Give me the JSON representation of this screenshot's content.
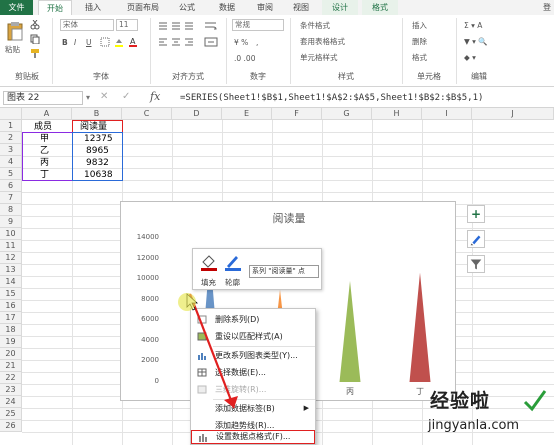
{
  "ribbon": {
    "tabs": [
      "文件",
      "开始",
      "插入",
      "页面布局",
      "公式",
      "数据",
      "审阅",
      "视图",
      "设计",
      "格式"
    ],
    "right_edge": "登",
    "paste_label": "粘贴",
    "font_name": "宋体",
    "font_size": "11",
    "number_format": "常规",
    "styles": [
      "条件格式",
      "套用表格格式",
      "单元格样式"
    ],
    "cells": [
      "插入",
      "删除",
      "格式"
    ],
    "groups": [
      "剪贴板",
      "字体",
      "对齐方式",
      "数字",
      "样式",
      "单元格",
      "编辑"
    ]
  },
  "formula_bar": {
    "name_box": "图表 22",
    "fx": "fx",
    "formula": "=SERIES(Sheet1!$B$1,Sheet1!$A$2:$A$5,Sheet1!$B$2:$B$5,1)"
  },
  "sheet": {
    "columns": [
      "A",
      "B",
      "C",
      "D",
      "E",
      "F",
      "G",
      "H",
      "I",
      "J"
    ],
    "rows": [
      "1",
      "2",
      "3",
      "4",
      "5",
      "6",
      "7",
      "8",
      "9",
      "10",
      "11",
      "12",
      "13",
      "14",
      "15",
      "16",
      "17",
      "18",
      "19",
      "20",
      "21",
      "22",
      "23",
      "24",
      "25",
      "26"
    ],
    "cells": {
      "A1": "成员",
      "B1": "阅读量",
      "A2": "甲",
      "B2": "12375",
      "A3": "乙",
      "B3": "8965",
      "A4": "丙",
      "B4": "9832",
      "A5": "丁",
      "B5": "10638"
    }
  },
  "chart_data": {
    "type": "bar",
    "title": "阅读量",
    "categories": [
      "甲",
      "乙",
      "丙",
      "丁"
    ],
    "series": [
      {
        "name": "阅读量",
        "values": [
          12375,
          8965,
          9832,
          10638
        ]
      }
    ],
    "ylim": [
      0,
      14000
    ],
    "yticks": [
      "0",
      "2000",
      "4000",
      "6000",
      "8000",
      "10000",
      "12000",
      "14000"
    ],
    "visible_x_labels": [
      "",
      "",
      "丙",
      "丁"
    ],
    "colors": [
      "#4f81bd",
      "#f79646",
      "#9bbb59",
      "#c0504d"
    ],
    "grid": false
  },
  "mini_toolbar": {
    "fill_label": "填充",
    "outline_label": "轮廓",
    "series_selector": "系列 \"阅读量\" 点"
  },
  "context_menu": {
    "items": [
      "删除系列(D)",
      "重设以匹配样式(A)",
      "更改系列图表类型(Y)...",
      "选择数据(E)...",
      "三维旋转(R)...",
      "添加数据标签(B)",
      "添加趋势线(R)...",
      "设置数据点格式(F)..."
    ]
  },
  "watermark": {
    "title": "经验啦",
    "url": "jingyanla.com"
  },
  "accent_colors": {
    "excel_green": "#217346",
    "highlight_red": "#e02020"
  }
}
